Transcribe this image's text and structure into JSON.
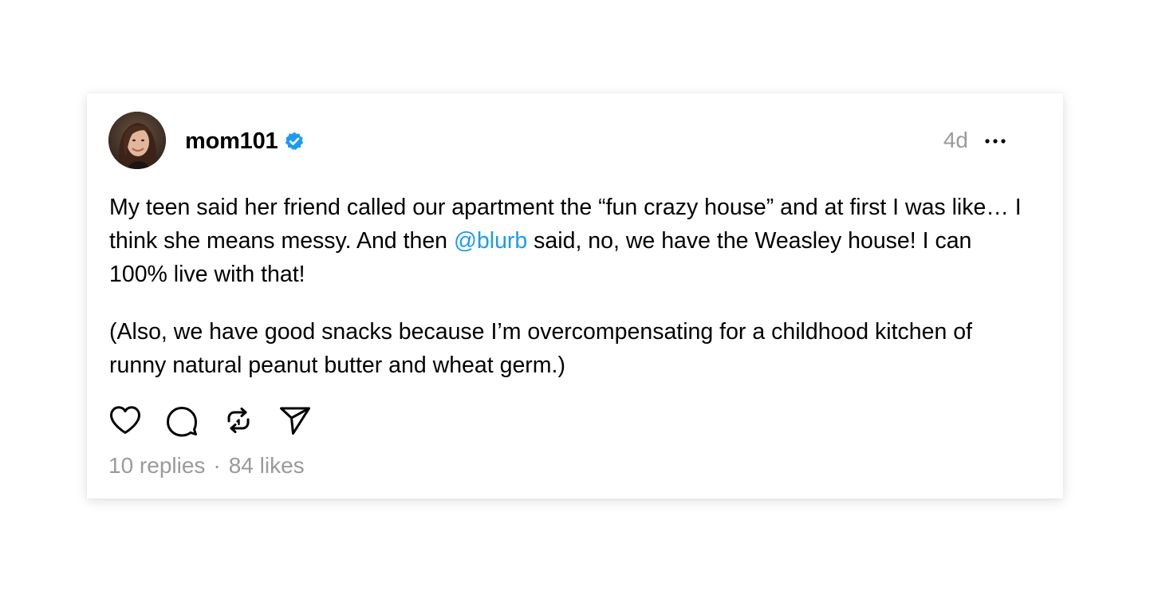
{
  "post": {
    "username": "mom101",
    "timestamp": "4d",
    "body": {
      "p1_before": "My teen said her friend called our apartment the “fun crazy house” and at first I was like… I think she means messy. And then ",
      "p1_mention": "@blurb",
      "p1_after": " said, no, we have the Weasley house! I can 100% live with that!",
      "p2": "(Also, we have good snacks because I’m overcompensating for a childhood kitchen of runny natural peanut butter and wheat germ.)"
    },
    "stats": {
      "replies": "10 replies",
      "separator": "·",
      "likes": "84 likes"
    }
  },
  "icons": {
    "verified": "verified-badge-icon",
    "more": "more-options-icon",
    "like": "heart-icon",
    "reply": "comment-icon",
    "repost": "repost-icon",
    "share": "send-icon"
  },
  "colors": {
    "verified_badge": "#1d9bf0",
    "mention": "#1d9bf0",
    "secondary_text": "#9a9a9a",
    "primary_text": "#000000"
  }
}
